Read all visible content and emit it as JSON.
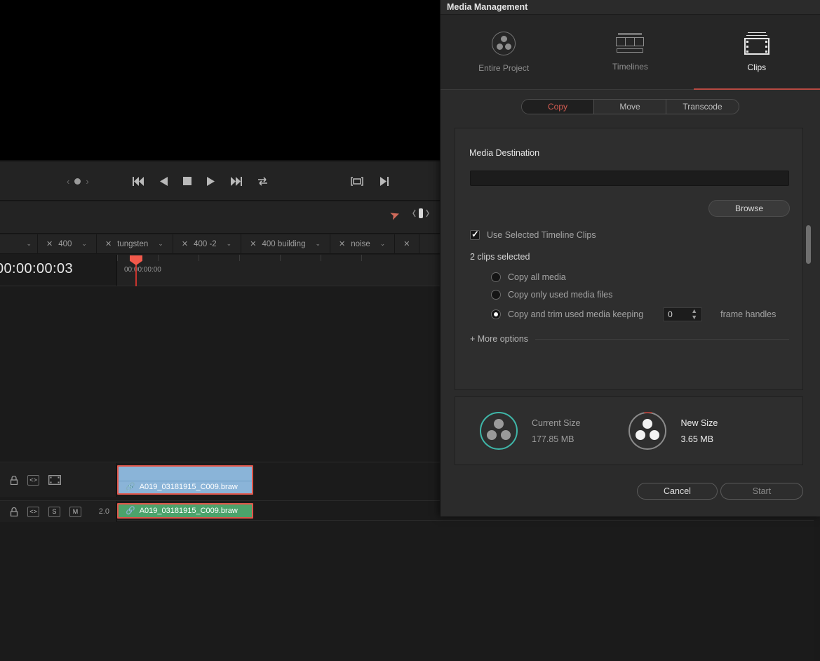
{
  "dialog": {
    "title": "Media Management",
    "mode_tabs": [
      {
        "label": "Entire Project",
        "icon": "resolve-logo-icon",
        "active": false
      },
      {
        "label": "Timelines",
        "icon": "timelines-icon",
        "active": false
      },
      {
        "label": "Clips",
        "icon": "clips-filmstrip-icon",
        "active": true
      }
    ],
    "operations": [
      {
        "label": "Copy",
        "active": true
      },
      {
        "label": "Move",
        "active": false
      },
      {
        "label": "Transcode",
        "active": false
      }
    ],
    "destination": {
      "label": "Media Destination",
      "value": "",
      "placeholder": "",
      "browse_label": "Browse"
    },
    "use_selected": {
      "label": "Use Selected Timeline Clips",
      "checked": true
    },
    "selection_count": "2 clips selected",
    "copy_options": [
      {
        "label": "Copy all media",
        "selected": false
      },
      {
        "label": "Copy only used media files",
        "selected": false
      },
      {
        "label": "Copy and trim used media keeping",
        "selected": true
      }
    ],
    "frame_handles": {
      "value": "0",
      "suffix_label": "frame handles"
    },
    "more_options_label": "+ More options",
    "sizes": [
      {
        "label": "Current Size",
        "value": "177.85 MB",
        "accent": "#3fb6a8"
      },
      {
        "label": "New Size",
        "value": "3.65 MB",
        "accent": "#a5403a"
      }
    ],
    "footer": {
      "cancel_label": "Cancel",
      "start_label": "Start"
    }
  },
  "editor": {
    "timeline_tabs": [
      {
        "label": "400"
      },
      {
        "label": "tungsten"
      },
      {
        "label": "400 -2"
      },
      {
        "label": "400 building"
      },
      {
        "label": "noise"
      }
    ],
    "timecode_current": "00:00:00:03",
    "ruler_start": "00:00:00:00",
    "tracks": [
      {
        "type": "video",
        "controls": [
          "lock-icon",
          "auto-select-icon",
          "video-track-icon"
        ],
        "clip_label": "A019_03181915_C009.braw",
        "color": "#8ab4d8"
      },
      {
        "type": "audio",
        "controls": [
          "lock-icon",
          "auto-select-icon",
          "S",
          "M"
        ],
        "level": "2.0",
        "clip_label": "A019_03181915_C009.braw",
        "color": "#4ca36b"
      }
    ],
    "transport": {
      "jog_prev": "‹",
      "jog_next": "›",
      "buttons": [
        "jump-to-start-icon",
        "play-reverse-icon",
        "stop-icon",
        "play-icon",
        "jump-to-end-icon",
        "loop-icon"
      ],
      "right_buttons": [
        "fit-to-frame-icon",
        "next-marker-icon"
      ]
    },
    "toolbar_tools": [
      "pointer-cursor-icon",
      "trim-edit-mode-icon",
      "dynamic-trim-icon"
    ]
  }
}
